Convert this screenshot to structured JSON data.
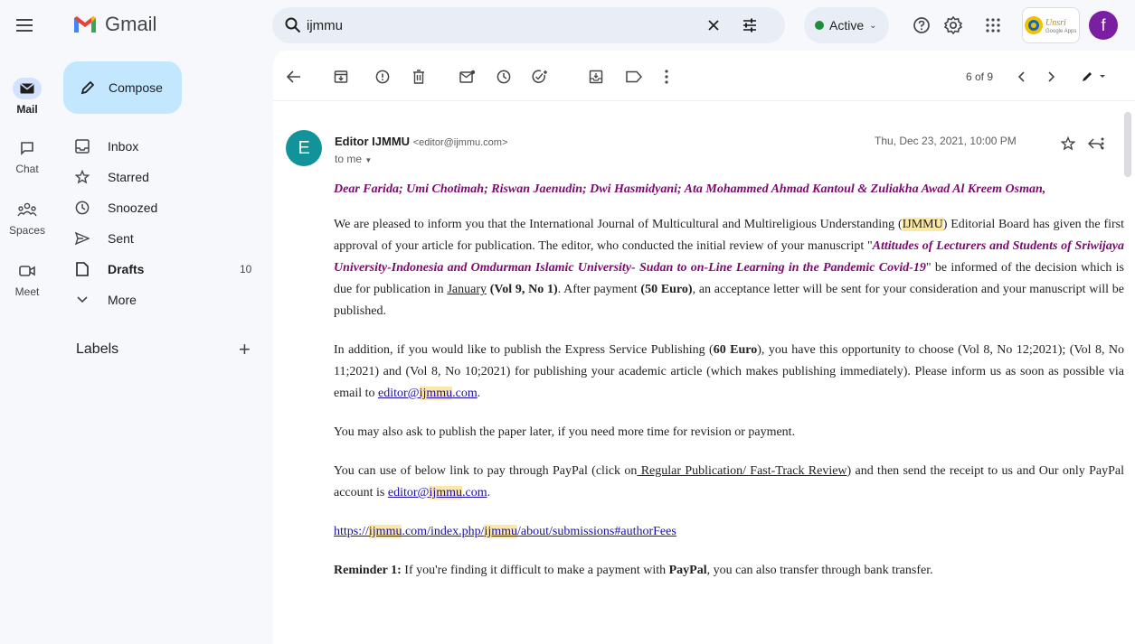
{
  "app": {
    "name": "Gmail"
  },
  "search": {
    "value": "ijmmu"
  },
  "status": {
    "label": "Active"
  },
  "rail": [
    {
      "label": "Mail"
    },
    {
      "label": "Chat"
    },
    {
      "label": "Spaces"
    },
    {
      "label": "Meet"
    }
  ],
  "compose": {
    "label": "Compose"
  },
  "nav": [
    {
      "label": "Inbox",
      "count": ""
    },
    {
      "label": "Starred",
      "count": ""
    },
    {
      "label": "Snoozed",
      "count": ""
    },
    {
      "label": "Sent",
      "count": ""
    },
    {
      "label": "Drafts",
      "count": "10"
    },
    {
      "label": "More",
      "count": ""
    }
  ],
  "labels": {
    "title": "Labels"
  },
  "pager": {
    "text": "6 of 9"
  },
  "email": {
    "avatar_letter": "E",
    "sender_name": "Editor IJMMU",
    "sender_email": "<editor@ijmmu.com>",
    "to": "to me",
    "date": "Thu, Dec 23, 2021, 10:00 PM",
    "salutation": "Dear Farida; Umi Chotimah; Riswan Jaenudin; Dwi Hasmidyani; Ata Mohammed Ahmad Kantoul & Zuliakha Awad Al Kreem Osman,",
    "p1": {
      "a": "We are pleased to inform you that the International Journal of Multicultural and Multireligious Understanding (",
      "hl": "IJMMU",
      "b": ") Editorial Board has given the first approval of your article for publication. The editor, who conducted the initial review of your manuscript \"",
      "title": "Attitudes of Lecturers and Students of Sriwijaya University-Indonesia and Omdurman Islamic University- Sudan to on-Line Learning  in the Pandemic Covid-19",
      "c": "\" be informed of the decision which is due for publication in ",
      "month": "January",
      "d": " ",
      "vol": "(Vol 9, No 1)",
      "e": ". After payment ",
      "pay": "(50 Euro)",
      "f": ", an acceptance letter will be sent for your consideration and your manuscript will be published."
    },
    "p2": {
      "a": "In addition, if you would like to publish the Express Service Publishing (",
      "price": "60 Euro",
      "b": "), you have this opportunity to choose (Vol 8, No 12;2021); (Vol 8, No 11;2021) and (Vol 8, No 10;2021) for publishing your academic article (which makes publishing immediately). Please inform us as soon as possible via email to ",
      "link_a": "editor@",
      "link_hl": "ijmmu",
      "link_b": ".com",
      "c": "."
    },
    "p3": "You may also ask to publish the paper later, if you need more time for revision or payment.",
    "p4": {
      "a": "You can use of below link to pay through PayPal (click on",
      "link": " Regular Publication/ Fast-Track Review",
      "b": ") and then send the receipt to us and Our only PayPal account is ",
      "link_a": "editor@",
      "link_hl": "ijmmu",
      "link_b": ".com",
      "c": "."
    },
    "url": {
      "a": "https://",
      "hl1": "ijmmu",
      "b": ".com/index.php/",
      "hl2": "ijmmu",
      "c": "/about/submissions#authorFees"
    },
    "reminder": {
      "label": "Reminder 1:",
      "a": " If you're finding it difficult to make a payment with ",
      "paypal": "PayPal",
      "b": ", you can also transfer through bank transfer."
    }
  }
}
